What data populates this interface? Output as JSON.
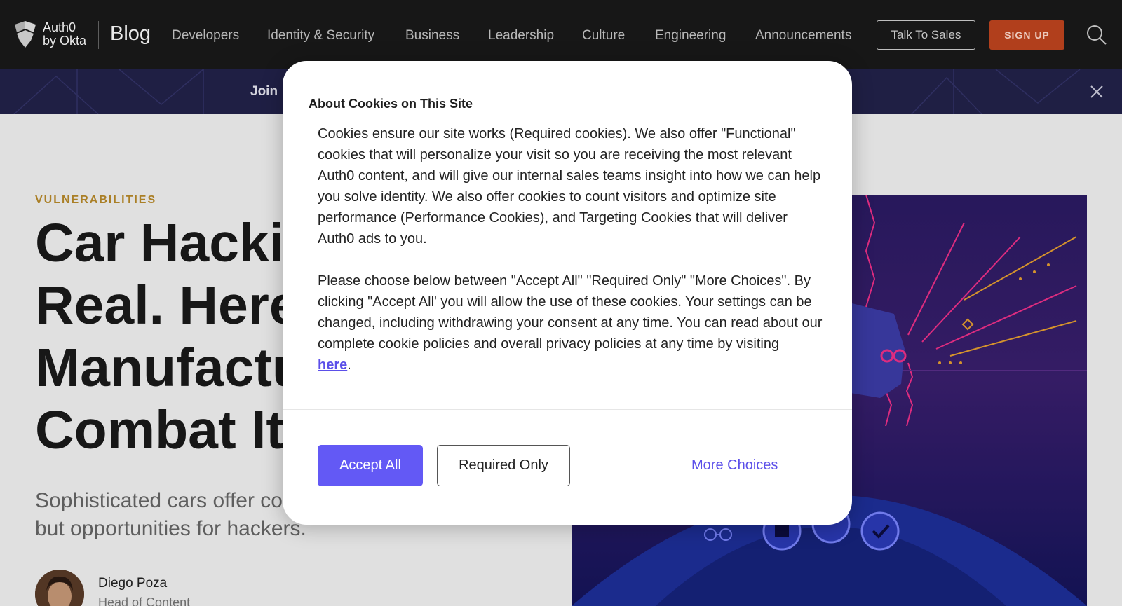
{
  "header": {
    "logo_text_line1": "Auth0",
    "logo_text_line2": "by Okta",
    "blog_label": "Blog",
    "nav": [
      "Developers",
      "Identity & Security",
      "Business",
      "Leadership",
      "Culture",
      "Engineering",
      "Announcements"
    ],
    "talk_to_sales": "Talk To Sales",
    "sign_up": "SIGN UP"
  },
  "banner": {
    "text": "Join"
  },
  "article": {
    "category": "VULNERABILITIES",
    "headline_lines": [
      "Car Hackin",
      "Real. Here’",
      "Manufactu",
      "Combat It"
    ],
    "subtitle_lines": [
      "Sophisticated cars offer co",
      "but opportunities for hackers."
    ],
    "author_name": "Diego Poza",
    "author_role": "Head of Content"
  },
  "modal": {
    "title": "About Cookies on This Site",
    "paragraph1": "Cookies ensure our site works (Required cookies). We also offer \"Functional\" cookies that will personalize your visit so you are receiving the most relevant Auth0 content, and will give our internal sales teams insight into how we can help you solve identity. We also offer cookies to count visitors and optimize site performance (Performance Cookies), and Targeting Cookies that will deliver Auth0 ads to you.",
    "paragraph2": "Please choose below between \"Accept All\" \"Required Only\" \"More Choices\". By clicking \"Accept All' you will allow the use of these cookies. Your settings can be changed, including withdrawing your consent at any time. You can read about our complete cookie policies and overall privacy policies at any time by visiting",
    "link_text": "here",
    "period": ".",
    "accept_all": "Accept All",
    "required_only": "Required Only",
    "more_choices": "More Choices"
  },
  "colors": {
    "accent": "#6359f5",
    "signup": "#c1451f",
    "category": "#b98a2a"
  }
}
